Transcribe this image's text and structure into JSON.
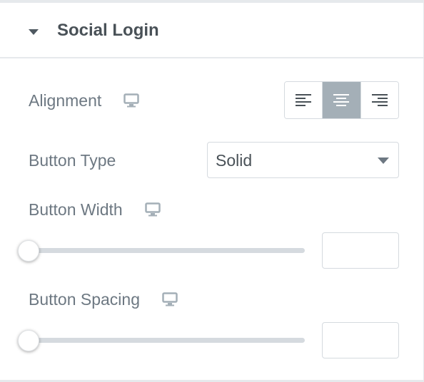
{
  "section": {
    "title": "Social Login",
    "expanded": true
  },
  "fields": {
    "alignment": {
      "label": "Alignment",
      "options": [
        "left",
        "center",
        "right"
      ],
      "selected": "center"
    },
    "button_type": {
      "label": "Button Type",
      "value": "Solid"
    },
    "button_width": {
      "label": "Button Width",
      "value": "",
      "slider_fraction": 0
    },
    "button_spacing": {
      "label": "Button Spacing",
      "value": "",
      "slider_fraction": 0
    }
  },
  "icons": {
    "responsive": "desktop-monitor-icon",
    "align_left": "align-left-icon",
    "align_center": "align-center-icon",
    "align_right": "align-right-icon"
  },
  "colors": {
    "active_toggle": "#a4afb7",
    "border": "#d5dadf",
    "label_text": "#6d7882",
    "title_text": "#495157"
  }
}
